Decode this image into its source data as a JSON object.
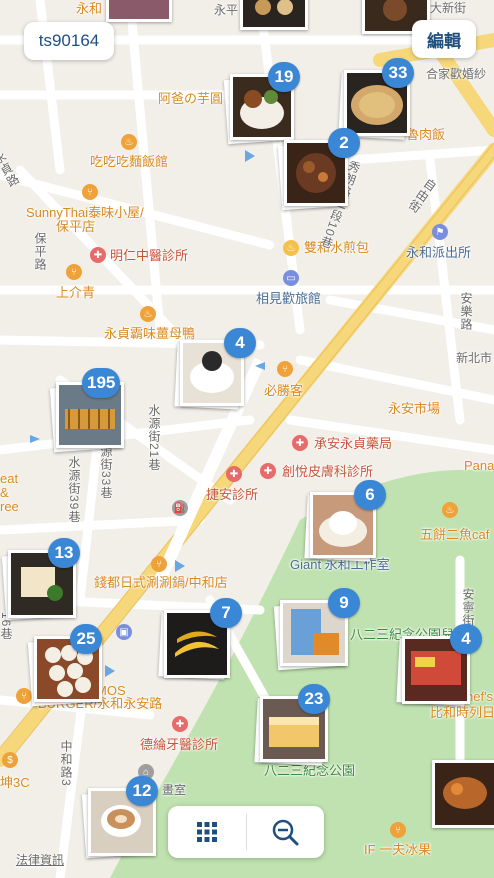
{
  "header": {
    "user_tag": "ts90164",
    "edit_label": "編輯"
  },
  "map_labels": {
    "yonghe_top": "永和",
    "yongping_top": "永平",
    "daxin": "大新街",
    "aba": "阿爸の芋圓",
    "hejia": "合家歡婚紗",
    "pork_rice": "魯肉飯",
    "chichi": "吃吃吃麵飯館",
    "sunnythai": "SunnyThai泰味小屋/",
    "baoping": "保平店",
    "baoping_rd": "保平路",
    "mingren": "明仁中醫診所",
    "shangjieqing": "上介青",
    "ziyou": "自由街",
    "shuanghe": "雙和水煎包",
    "yonghe_police": "永和派出所",
    "anle": "安樂路",
    "xiangjian": "相見歡旅館",
    "xiushang": "秀朗路二段10巷",
    "yongzhen_noodle": "永貞霸味薑母鴨",
    "bishengke": "必勝客",
    "xinbeishi": "新北市",
    "yongan_market": "永安市場",
    "shuiyuan21": "水源街21巷",
    "shuiyuan33": "水源街33巷",
    "shuiyuan39": "水源街39巷",
    "yongzhen_pharm": "承安永貞藥局",
    "chuangshi": "創悅皮膚科診所",
    "jiean": "捷安診所",
    "pana": "Pana",
    "wubing": "五餅二魚caf",
    "giant": "Giant 永和工作室",
    "qiandu": "錢都日式涮涮鍋/中和店",
    "eat": "eat",
    "amp": "&",
    "ree": "ree",
    "yongzhen_rd": "永貞路",
    "anning": "安寧街",
    "eragon_park_ne": "八二三紀念公園兒中心",
    "mos": "MOS",
    "mos_yonghe": "BURGER/永和永安路",
    "chef": "hef's",
    "bihe": "比和時列日",
    "deyu": "德綸牙醫診所",
    "park": "八二三紀念公園",
    "zhonghe3": "中和路3",
    "kun3c": "坤3C",
    "huashi": "畫室",
    "legal": "法律資訊",
    "if_icefood": "IF 一夫冰果",
    "road_16": "16巷"
  },
  "pins": [
    {
      "id": "p19",
      "count": "19",
      "photo": "rice"
    },
    {
      "id": "p33",
      "count": "33",
      "photo": "soup"
    },
    {
      "id": "p2",
      "count": "2",
      "photo": "meat"
    },
    {
      "id": "p4a",
      "count": "4",
      "photo": "tofu"
    },
    {
      "id": "p195",
      "count": "195",
      "photo": "grill"
    },
    {
      "id": "p6",
      "count": "6",
      "photo": "cake"
    },
    {
      "id": "p13",
      "count": "13",
      "photo": "tofu2"
    },
    {
      "id": "p7",
      "count": "7",
      "photo": "banana"
    },
    {
      "id": "p9",
      "count": "9",
      "photo": "pack"
    },
    {
      "id": "p4b",
      "count": "4",
      "photo": "box"
    },
    {
      "id": "p25",
      "count": "25",
      "photo": "dumpling"
    },
    {
      "id": "p23",
      "count": "23",
      "photo": "toast"
    },
    {
      "id": "p12",
      "count": "12",
      "photo": "latte"
    },
    {
      "id": "p_right",
      "count": "",
      "photo": "chicken"
    }
  ],
  "toolbar": {
    "grid_icon": "grid-icon",
    "zoom_out_icon": "zoom-out-icon"
  },
  "colors": {
    "badge": "#3a87d6",
    "park": "#bfe2b0",
    "major_road": "#f6d77a",
    "road": "#ffffff"
  }
}
